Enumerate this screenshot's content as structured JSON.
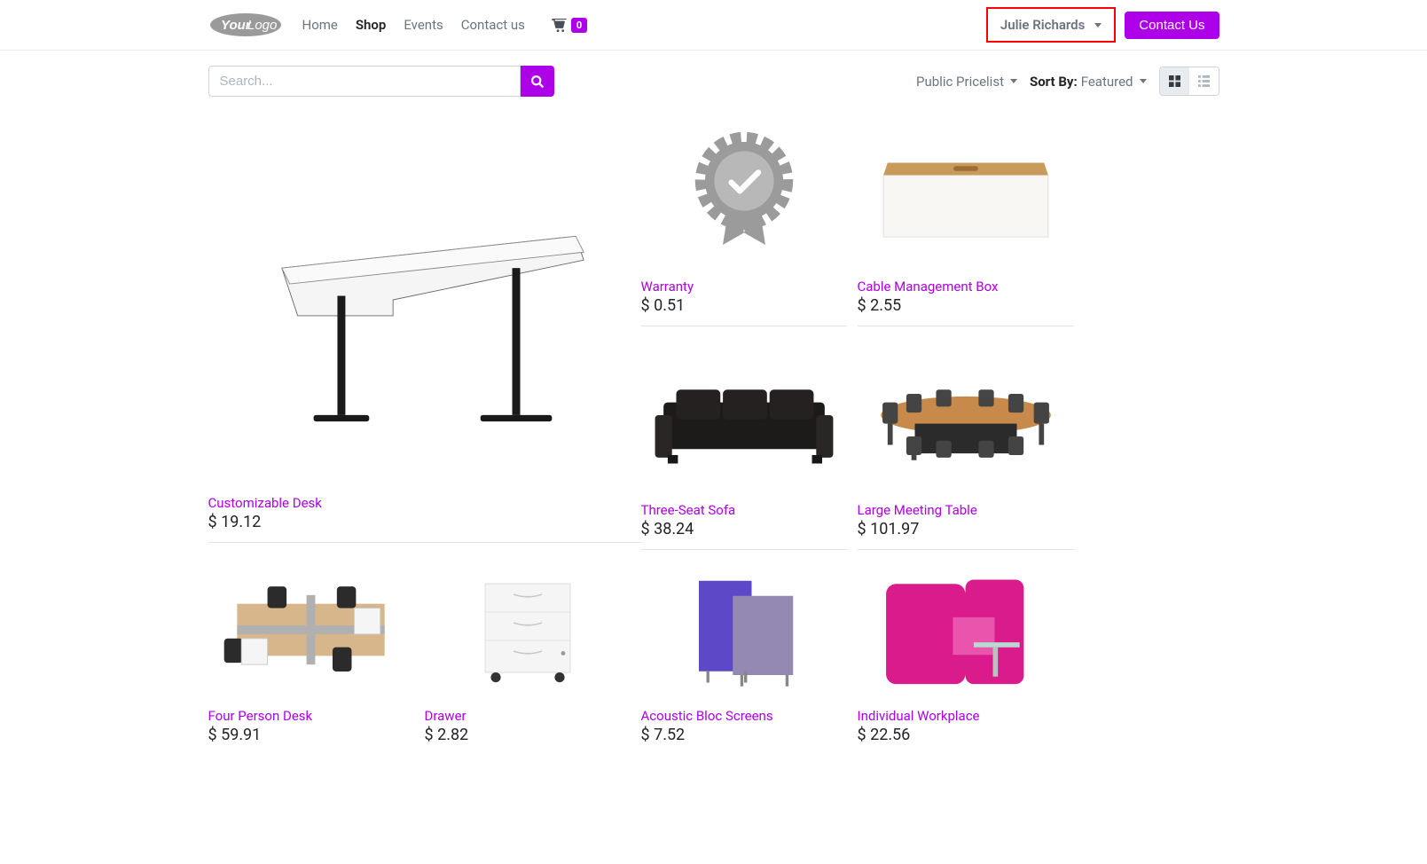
{
  "header": {
    "nav": {
      "home": "Home",
      "shop": "Shop",
      "events": "Events",
      "contact": "Contact us"
    },
    "cart_count": "0",
    "user_name": "Julie Richards",
    "contact_btn": "Contact Us"
  },
  "toolbar": {
    "search_placeholder": "Search...",
    "pricelist": "Public Pricelist",
    "sort_label": "Sort By:",
    "sort_value": "Featured"
  },
  "products": [
    {
      "name": "Customizable Desk",
      "price": "$ 19.12"
    },
    {
      "name": "Warranty",
      "price": "$ 0.51"
    },
    {
      "name": "Cable Management Box",
      "price": "$ 2.55"
    },
    {
      "name": "Three-Seat Sofa",
      "price": "$ 38.24"
    },
    {
      "name": "Large Meeting Table",
      "price": "$ 101.97"
    },
    {
      "name": "Four Person Desk",
      "price": "$ 59.91"
    },
    {
      "name": "Drawer",
      "price": "$ 2.82"
    },
    {
      "name": "Acoustic Bloc Screens",
      "price": "$ 7.52"
    },
    {
      "name": "Individual Workplace",
      "price": "$ 22.56"
    }
  ]
}
